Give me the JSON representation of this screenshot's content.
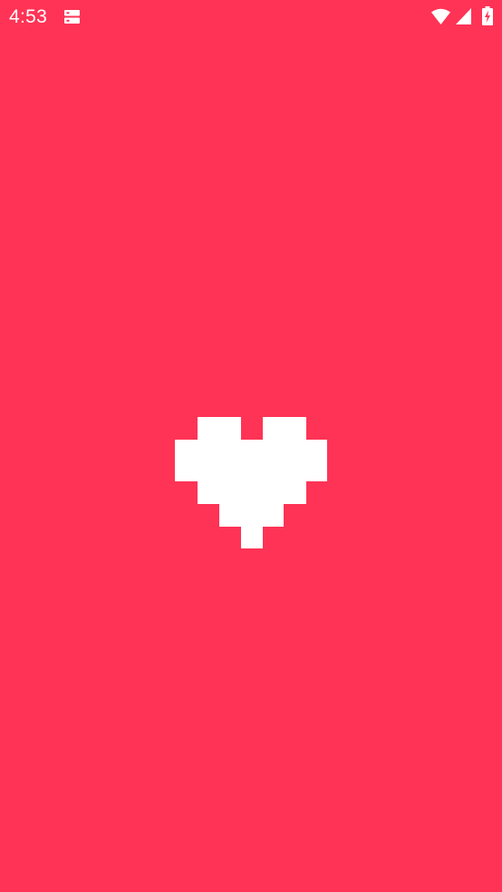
{
  "status_bar": {
    "time": "4:53",
    "notification_icon": "storage-icon",
    "wifi_icon": "wifi-icon",
    "signal_icon": "cell-signal-icon",
    "battery_icon": "battery-charging-icon"
  },
  "splash": {
    "background_color": "#FF3355",
    "logo_icon": "pixel-heart-icon",
    "logo_color": "#FFFFFF"
  }
}
